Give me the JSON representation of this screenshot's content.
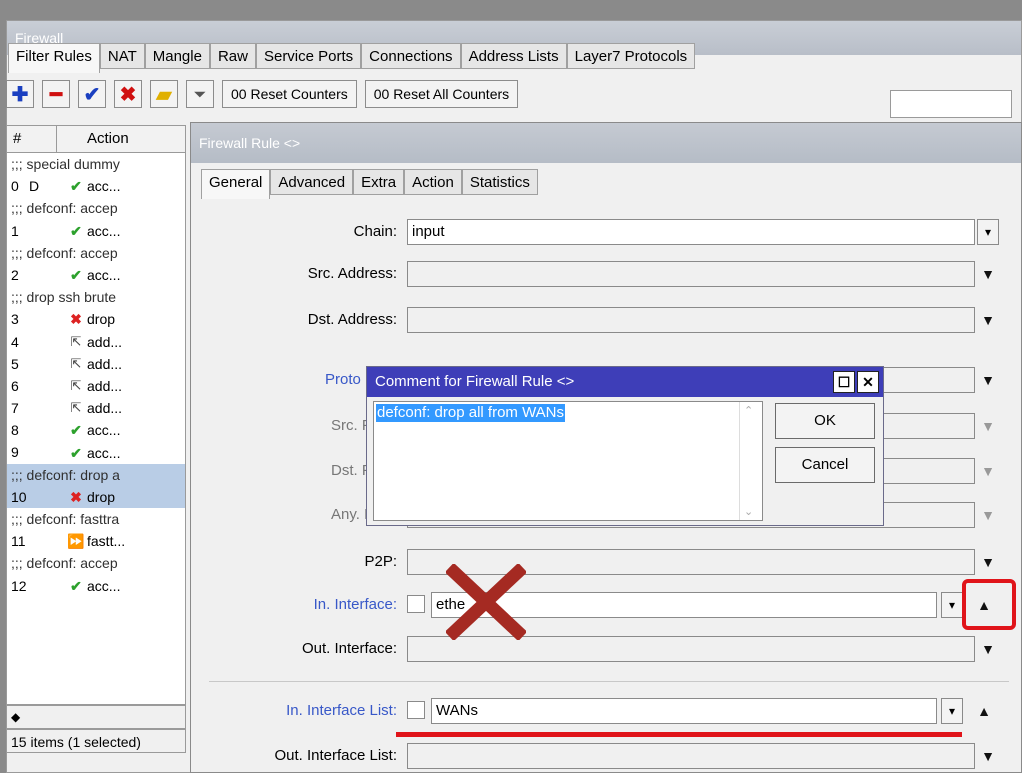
{
  "firewall": {
    "title": "Firewall",
    "tabs": [
      "Filter Rules",
      "NAT",
      "Mangle",
      "Raw",
      "Service Ports",
      "Connections",
      "Address Lists",
      "Layer7 Protocols"
    ],
    "toolbar": {
      "reset_counters": "00 Reset Counters",
      "reset_all_counters": "00 Reset All Counters"
    },
    "list": {
      "headers": [
        "#",
        "Action"
      ],
      "rows": [
        {
          "type": "comment",
          "text": ";;; special dummy"
        },
        {
          "type": "rule",
          "num": "0",
          "flag": "D",
          "icon": "ok",
          "action": "acc..."
        },
        {
          "type": "comment",
          "text": ";;; defconf: accep"
        },
        {
          "type": "rule",
          "num": "1",
          "flag": "",
          "icon": "ok",
          "action": "acc..."
        },
        {
          "type": "comment",
          "text": ";;; defconf: accep"
        },
        {
          "type": "rule",
          "num": "2",
          "flag": "",
          "icon": "ok",
          "action": "acc..."
        },
        {
          "type": "comment",
          "text": ";;; drop ssh brute"
        },
        {
          "type": "rule",
          "num": "3",
          "flag": "",
          "icon": "drop",
          "action": "drop"
        },
        {
          "type": "rule",
          "num": "4",
          "flag": "",
          "icon": "add",
          "action": "add..."
        },
        {
          "type": "rule",
          "num": "5",
          "flag": "",
          "icon": "add",
          "action": "add..."
        },
        {
          "type": "rule",
          "num": "6",
          "flag": "",
          "icon": "add",
          "action": "add..."
        },
        {
          "type": "rule",
          "num": "7",
          "flag": "",
          "icon": "add",
          "action": "add..."
        },
        {
          "type": "rule",
          "num": "8",
          "flag": "",
          "icon": "ok",
          "action": "acc..."
        },
        {
          "type": "rule",
          "num": "9",
          "flag": "",
          "icon": "ok",
          "action": "acc..."
        },
        {
          "type": "comment",
          "text": ";;; defconf: drop a",
          "selected": true
        },
        {
          "type": "rule",
          "num": "10",
          "flag": "",
          "icon": "drop",
          "action": "drop",
          "selected": true
        },
        {
          "type": "comment",
          "text": ";;; defconf: fasttra"
        },
        {
          "type": "rule",
          "num": "11",
          "flag": "",
          "icon": "fast",
          "action": "fastt..."
        },
        {
          "type": "comment",
          "text": ";;; defconf: accep"
        },
        {
          "type": "rule",
          "num": "12",
          "flag": "",
          "icon": "ok",
          "action": "acc..."
        }
      ]
    },
    "status": "15 items (1 selected)"
  },
  "rule_dialog": {
    "title": "Firewall Rule <>",
    "tabs": [
      "General",
      "Advanced",
      "Extra",
      "Action",
      "Statistics"
    ],
    "fields": {
      "chain": {
        "label": "Chain:",
        "value": "input"
      },
      "src_address": {
        "label": "Src. Address:"
      },
      "dst_address": {
        "label": "Dst. Address:"
      },
      "protocol": {
        "label": "Proto"
      },
      "src_port": {
        "label": "Src. F"
      },
      "dst_port": {
        "label": "Dst. F"
      },
      "any_port": {
        "label": "Any. F"
      },
      "p2p": {
        "label": "P2P:"
      },
      "in_interface": {
        "label": "In. Interface:",
        "value": "ethe"
      },
      "out_interface": {
        "label": "Out. Interface:"
      },
      "in_interface_list": {
        "label": "In. Interface List:",
        "value": "WANs"
      },
      "out_interface_list": {
        "label": "Out. Interface List:"
      }
    }
  },
  "comment_dialog": {
    "title": "Comment for Firewall Rule <>",
    "text": "defconf: drop all from WANs",
    "ok_label": "OK",
    "cancel_label": "Cancel"
  },
  "colors": {
    "annotation_red": "#e0141a",
    "dialog_title_blue": "#3e3eb8",
    "selection": "#b9cde6"
  }
}
